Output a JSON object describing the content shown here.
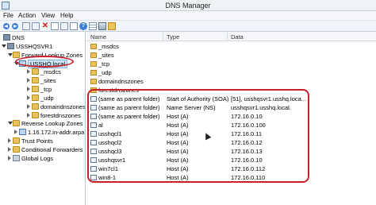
{
  "window": {
    "title": "DNS Manager"
  },
  "menu": [
    "File",
    "Action",
    "View",
    "Help"
  ],
  "toolbar": {
    "icons": [
      "back-arrow-icon",
      "forward-arrow-icon",
      "up-level-icon",
      "show-hide-tree-icon",
      "delete-icon",
      "properties-icon",
      "refresh-icon",
      "export-list-icon",
      "help-icon",
      "grid-view-icon",
      "server-icon",
      "folder-view-icon"
    ]
  },
  "tree": [
    {
      "label": "DNS",
      "icon": "dns-icon",
      "expanded": true
    },
    {
      "label": "USSHQSVR1",
      "icon": "server-icon",
      "expanded": true
    },
    {
      "label": "Forward Lookup Zones",
      "icon": "folder-icon",
      "expanded": true
    },
    {
      "label": "USSHQ.local",
      "icon": "zone-icon",
      "expanded": true,
      "selected": true
    },
    {
      "label": "_msdcs",
      "icon": "folder-icon"
    },
    {
      "label": "_sites",
      "icon": "folder-icon"
    },
    {
      "label": "_tcp",
      "icon": "folder-icon"
    },
    {
      "label": "_udp",
      "icon": "folder-icon"
    },
    {
      "label": "domaindnszones",
      "icon": "folder-icon"
    },
    {
      "label": "forestdnszones",
      "icon": "folder-icon"
    },
    {
      "label": "Reverse Lookup Zones",
      "icon": "folder-icon",
      "expanded": true
    },
    {
      "label": "1.16.172.in-addr.arpa",
      "icon": "zone-icon"
    },
    {
      "label": "Trust Points",
      "icon": "folder-icon"
    },
    {
      "label": "Conditional Forwarders",
      "icon": "folder-icon"
    },
    {
      "label": "Global Logs",
      "icon": "logs-icon"
    }
  ],
  "columns": [
    "Name",
    "Type",
    "Data"
  ],
  "rows": [
    {
      "name": "_msdcs",
      "type": "",
      "data": "",
      "icon": "folder-icon"
    },
    {
      "name": "_sites",
      "type": "",
      "data": "",
      "icon": "folder-icon"
    },
    {
      "name": "_tcp",
      "type": "",
      "data": "",
      "icon": "folder-icon"
    },
    {
      "name": "_udp",
      "type": "",
      "data": "",
      "icon": "folder-icon"
    },
    {
      "name": "domaindnszones",
      "type": "",
      "data": "",
      "icon": "folder-icon"
    },
    {
      "name": "forestdnszones",
      "type": "",
      "data": "",
      "icon": "folder-icon"
    },
    {
      "name": "(same as parent folder)",
      "type": "Start of Authority (SOA)",
      "data": "[51], usshqsvr1.usshq.loca...",
      "icon": "record-icon"
    },
    {
      "name": "(same as parent folder)",
      "type": "Name Server (NS)",
      "data": "usshqsvr1.usshq.local.",
      "icon": "record-icon"
    },
    {
      "name": "(same as parent folder)",
      "type": "Host (A)",
      "data": "172.16.0.10",
      "icon": "record-icon"
    },
    {
      "name": "al",
      "type": "Host (A)",
      "data": "172.16.0.100",
      "icon": "record-icon"
    },
    {
      "name": "usshqcl1",
      "type": "Host (A)",
      "data": "172.16.0.11",
      "icon": "record-icon"
    },
    {
      "name": "usshqcl2",
      "type": "Host (A)",
      "data": "172.16.0.12",
      "icon": "record-icon"
    },
    {
      "name": "usshqcl3",
      "type": "Host (A)",
      "data": "172.16.0.13",
      "icon": "record-icon"
    },
    {
      "name": "usshqsvr1",
      "type": "Host (A)",
      "data": "172.16.0.10",
      "icon": "record-icon"
    },
    {
      "name": "win7cl1",
      "type": "Host (A)",
      "data": "172.16.0.112",
      "icon": "record-icon"
    },
    {
      "name": "win8-1",
      "type": "Host (A)",
      "data": "172.16.0.110",
      "icon": "record-icon"
    }
  ],
  "colors": {
    "annotation_ring": "#c8202a",
    "selection": "#cce4f7"
  }
}
